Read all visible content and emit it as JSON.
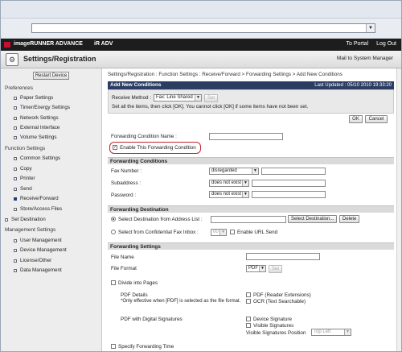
{
  "header": {
    "brand": "imageRUNNER ADVANCE",
    "device": "iR ADV",
    "links": [
      "To Portal",
      "Log Out"
    ],
    "page_title": "Settings/Registration",
    "mail_link": "Mail to System Manager"
  },
  "sidebar": {
    "restart_button": "Restart Device",
    "preferences": {
      "title": "Preferences",
      "items": [
        "Paper Settings",
        "Timer/Energy Settings",
        "Network Settings",
        "External Interface",
        "Volume Settings"
      ]
    },
    "function_settings": {
      "title": "Function Settings",
      "items": [
        "Common Settings",
        "Copy",
        "Printer",
        "Send",
        "Receive/Forward",
        "Store/Access Files"
      ]
    },
    "set_destination": "Set Destination",
    "management_settings": {
      "title": "Management Settings",
      "items": [
        "User Management",
        "Device Management",
        "License/Other",
        "Data Management"
      ]
    }
  },
  "main": {
    "breadcrumb": "Settings/Registration : Function Settings : Receive/Forward > Forwarding Settings > Add New Conditions",
    "panel_title": "Add New Conditions",
    "last_updated": "Last Updated : 05/10 2010 19:33:20",
    "receive_method_label": "Receive Method :",
    "receive_method_value": "Fax: Line Shared",
    "set_button": "Set",
    "instruction": "Set all the items, then click [OK]. You cannot click [OK] if some items have not been set.",
    "ok_button": "OK",
    "cancel_button": "Cancel",
    "condition_name_label": "Forwarding Condition Name :",
    "enable_condition_label": "Enable This Forwarding Condition",
    "forwarding_conditions": {
      "title": "Forwarding Conditions",
      "fax_number_label": "Fax Number :",
      "fax_number_value": "disregarded",
      "subaddress_label": "Subaddress :",
      "subaddress_value": "does not exist",
      "password_label": "Password :",
      "password_value": "does not exist"
    },
    "forwarding_destination": {
      "title": "Forwarding Destination",
      "select_from_address": "Select Destination from Address List :",
      "select_destination_button": "Select Destination...",
      "delete_button": "Delete",
      "select_from_inbox": "Select from Confidential Fax Inbox :",
      "inbox_value": "00",
      "enable_url_send": "Enable URL Send"
    },
    "forwarding_settings": {
      "title": "Forwarding Settings",
      "file_name_label": "File Name",
      "file_format_label": "File Format",
      "file_format_value": "PDF",
      "set_button": "Set",
      "divide_pages": "Divide into Pages",
      "pdf_details_label": "PDF Details",
      "pdf_details_note": "*Only effective when [PDF] is selected as the file format.",
      "pdf_reader_ext": "PDF (Reader Extensions)",
      "ocr": "OCR (Text Searchable)",
      "pdf_digital_sig": "PDF with Digital Signatures",
      "device_signature": "Device Signature",
      "visible_signatures": "Visible Signatures",
      "visible_sig_position_label": "Visible Signatures Position",
      "visible_sig_position_value": "Top Left",
      "specify_forwarding_time": "Specify Forwarding Time"
    }
  }
}
